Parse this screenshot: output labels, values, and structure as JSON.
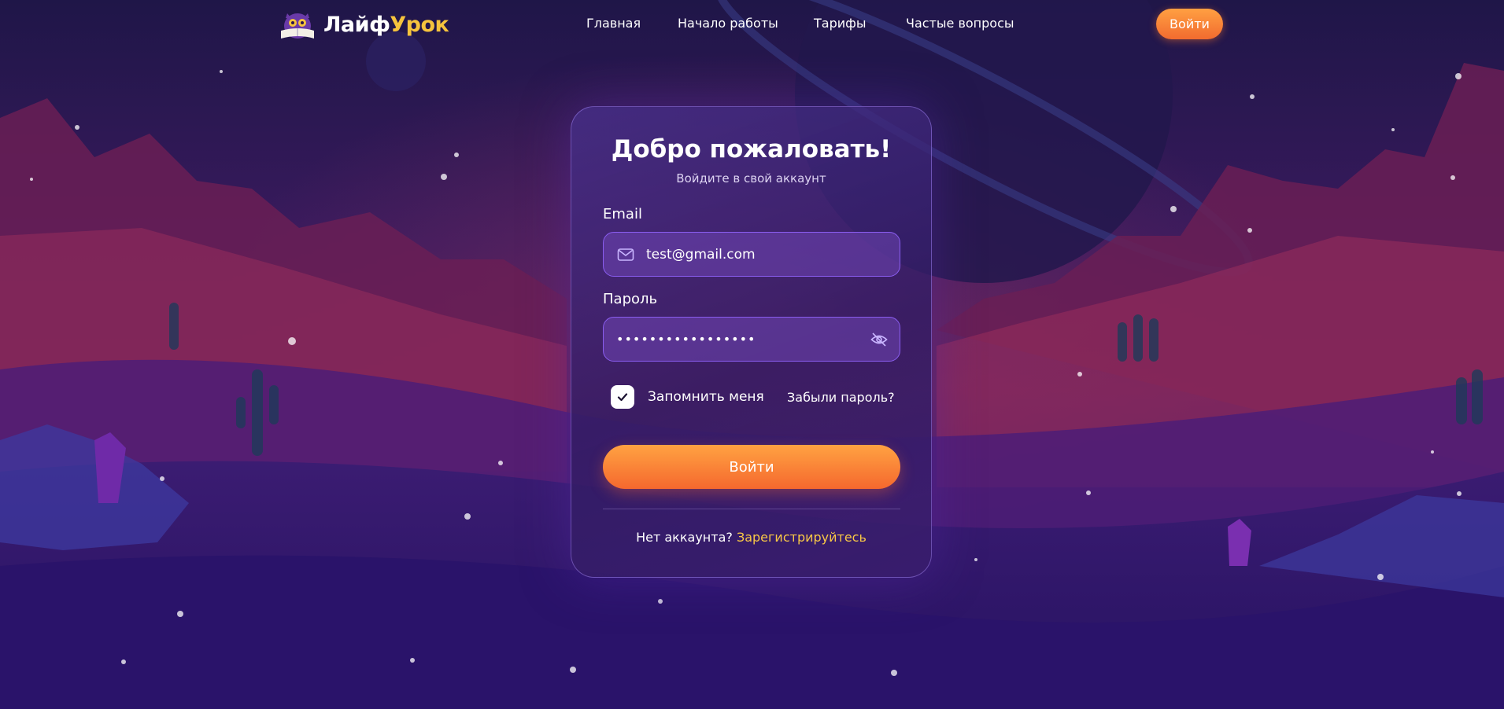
{
  "brand": {
    "name_part1": "Лайф",
    "name_part2": "Урок"
  },
  "nav": {
    "items": [
      {
        "label": "Главная"
      },
      {
        "label": "Начало работы"
      },
      {
        "label": "Тарифы"
      },
      {
        "label": "Частые вопросы"
      }
    ],
    "login_button": "Войти"
  },
  "form": {
    "title": "Добро пожаловать!",
    "subtitle": "Войдите в свой аккаунт",
    "email_label": "Email",
    "email_value": "test@gmail.com",
    "password_label": "Пароль",
    "password_value": "•••••••••••••••••",
    "remember_label": "Запомнить меня",
    "remember_checked": true,
    "forgot_link": "Забыли пароль?",
    "submit_label": "Войти",
    "no_account_text": "Нет аккаунта?",
    "register_link": "Зарегистрируйтесь"
  },
  "icons": {
    "email_field_icon": "mail-icon",
    "password_toggle_icon": "eye-off-icon",
    "checkbox_icon": "check-icon",
    "logo_icon": "owl-book-icon"
  },
  "colors": {
    "accent_orange": "#f5682e",
    "accent_gold": "#f6c33d",
    "field_border": "#8a5df0"
  }
}
